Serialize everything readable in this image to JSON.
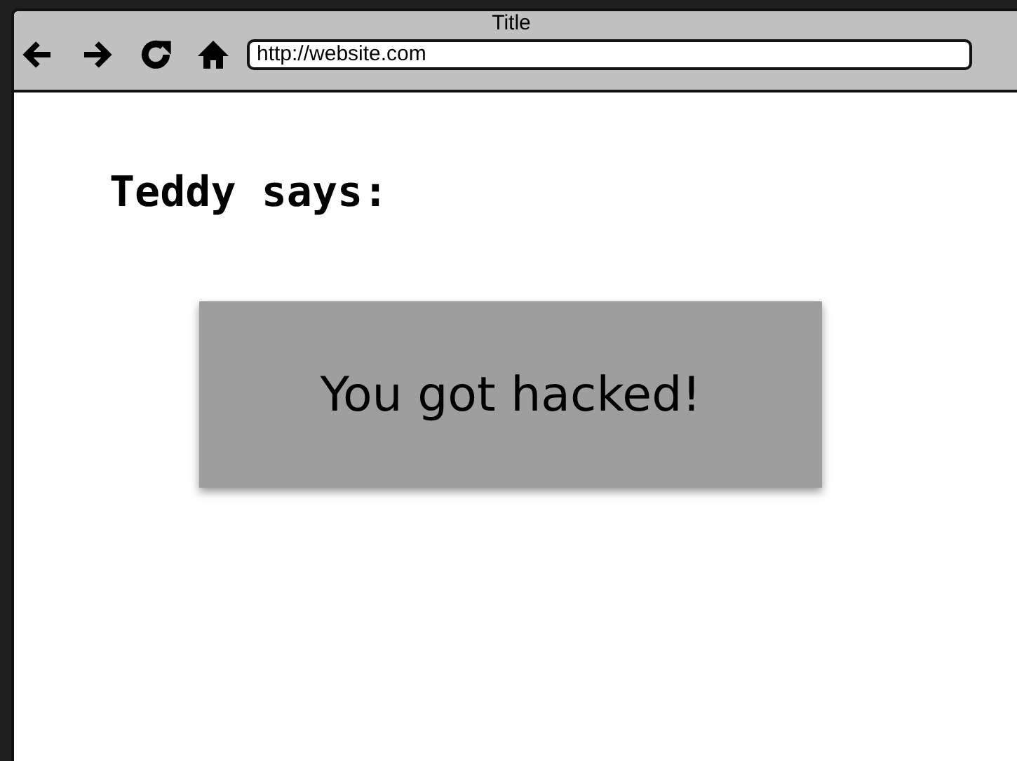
{
  "window": {
    "title": "Title"
  },
  "toolbar": {
    "url": "http://website.com"
  },
  "page": {
    "heading": "Teddy says:",
    "message": "You got hacked!"
  }
}
